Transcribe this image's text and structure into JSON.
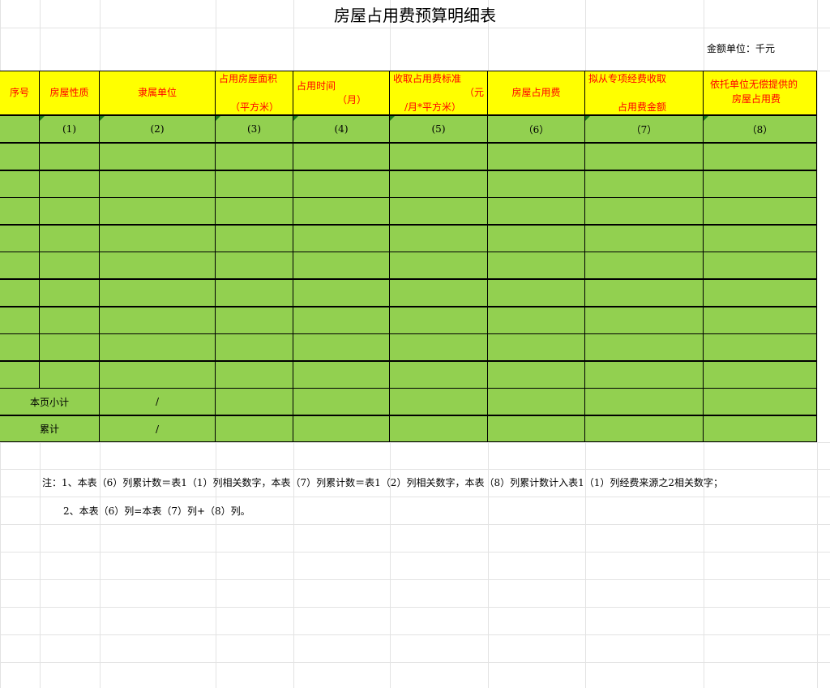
{
  "title": "房屋占用费预算明细表",
  "unit_label": "金额单位：千元",
  "headers": {
    "seq": "序号",
    "nature": "房屋性质",
    "unit": "隶属单位",
    "area_1": "占用房屋面积",
    "area_2": "（平方米）",
    "time_1": "占用时间",
    "time_2": "（月）",
    "std_1": "收取占用费标准",
    "std_2": "（元",
    "std_3": "/月*平方米）",
    "fee": "房屋占用费",
    "special_1": "拟从专项经费收取",
    "special_2": "占用费金额",
    "free_1": "依托单位无偿提供的",
    "free_2": "房屋占用费"
  },
  "column_numbers": [
    "(1)",
    "(2)",
    "(3)",
    "(4)",
    "(5)",
    "（6）",
    "（7）",
    "（8）"
  ],
  "subtotal_label": "本页小计",
  "cumulative_label": "累计",
  "slash": "/",
  "notes": [
    "注：1、本表（6）列累计数＝表1（1）列相关数字，本表（7）列累计数＝表1（2）列相关数字，本表（8）列累计数计入表1（1）列经费来源之2相关数字；",
    "2、本表（6）列=本表（7）列+（8）列。"
  ],
  "colors": {
    "header_bg": "#ffff00",
    "header_text": "#ff0000",
    "body_bg": "#92d050",
    "border": "#000000"
  }
}
